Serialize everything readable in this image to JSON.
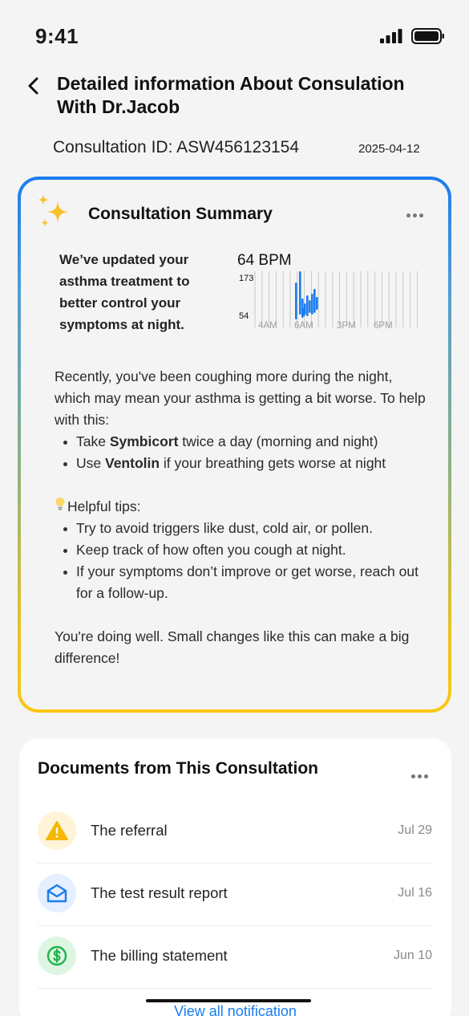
{
  "status_bar": {
    "time": "9:41"
  },
  "header": {
    "title": "Detailed information About Consulation With Dr.Jacob",
    "consultation_id": "Consultation ID: ASW456123154",
    "date": "2025-04-12"
  },
  "summary": {
    "title": "Consultation Summary",
    "highlight": "We’ve updated your asthma treatment to better control your symptoms at night.",
    "bpm": {
      "value_label": "64 BPM",
      "y_max_label": "173",
      "y_min_label": "54",
      "x_labels": [
        "4AM",
        "6AM",
        "3PM",
        "6PM"
      ]
    },
    "intro": "Recently, you've been coughing more during the night, which may mean your asthma is getting a bit worse. To help with this:",
    "treatments": [
      {
        "prefix": "Take ",
        "bold": "Symbicort",
        "suffix": " twice a day (morning and night)"
      },
      {
        "prefix": "Use ",
        "bold": "Ventolin",
        "suffix": " if your breathing gets worse at night"
      }
    ],
    "tips_heading": "Helpful tips:",
    "tips": [
      "Try to avoid triggers like dust, cold air, or pollen.",
      "Keep track of how often you cough at night.",
      "If your symptoms don’t improve or get worse, reach out for a follow-up."
    ],
    "closing": "You're doing well. Small changes like this can make a big difference!"
  },
  "documents": {
    "title": "Documents from This Consultation",
    "items": [
      {
        "name": "The referral",
        "date": "Jul 29",
        "icon": "warning-icon",
        "bg": "#fff4d6",
        "color": "#f5b800"
      },
      {
        "name": "The test result report",
        "date": "Jul 16",
        "icon": "mail-open-icon",
        "bg": "#e4efff",
        "color": "#1a7cf0"
      },
      {
        "name": "The billing statement",
        "date": "Jun 10",
        "icon": "dollar-icon",
        "bg": "#ddf6e2",
        "color": "#1fb34a"
      }
    ],
    "view_all": "View all notification"
  },
  "colors": {
    "accent_blue": "#1a7cf0",
    "accent_yellow": "#fcc712"
  }
}
